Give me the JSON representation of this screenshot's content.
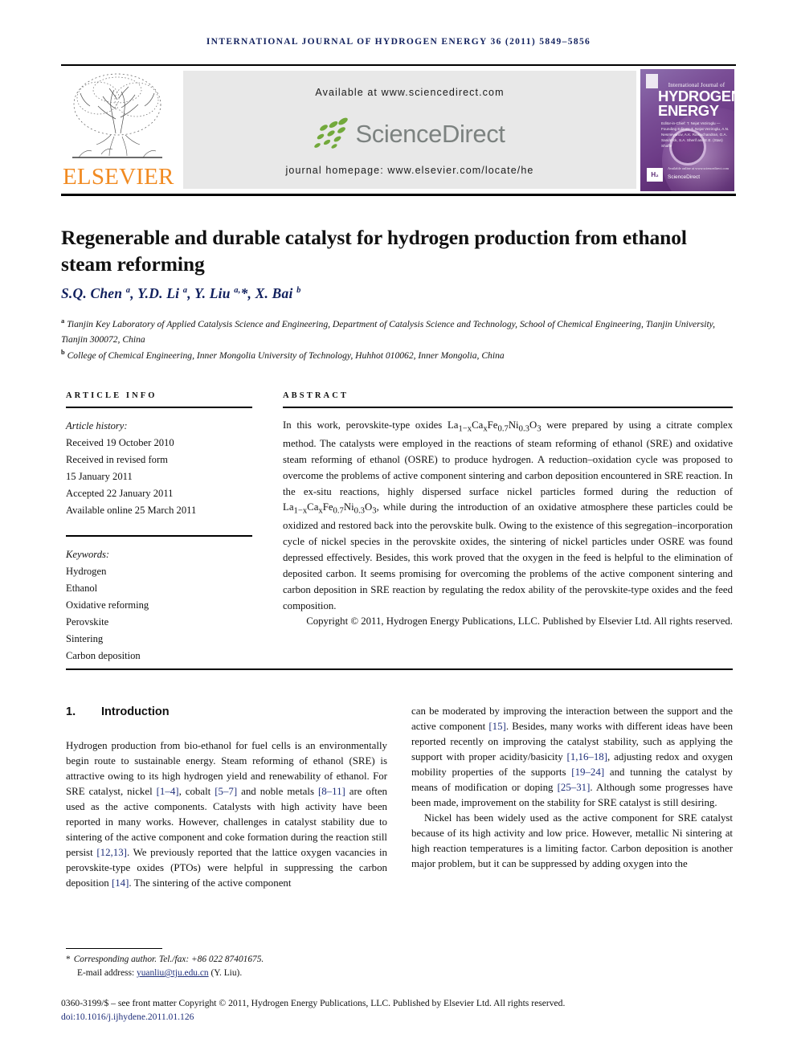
{
  "running_head": "International Journal of Hydrogen Energy 36 (2011) 5849–5856",
  "banner": {
    "publisher_name": "ELSEVIER",
    "available_at": "Available at www.sciencedirect.com",
    "sciencedirect_word": "ScienceDirect",
    "journal_homepage": "journal homepage: www.elsevier.com/locate/he",
    "cover": {
      "top_line": "International Journal of",
      "title_line1": "HYDROGEN",
      "title_line2": "ENERGY",
      "meta": "Editor-in-Chief: T. Nejat Veziroglu — Founding Editors: T. Nejat Veziroglu, A.N. Nesmeyanov, A.K. Ramachandran, G.A. Sandrock, S.A. Sherif and E.E. (Stan) Shaffe",
      "he_badge": "H₂",
      "sciencedirect_badge": "ScienceDirect",
      "bottom_note": "Available online at www.sciencedirect.com"
    }
  },
  "article": {
    "title": "Regenerable and durable catalyst for hydrogen production from ethanol steam reforming",
    "authors_html": "S.Q. Chen <sup>a</sup>, Y.D. Li <sup>a</sup>, Y. Liu <sup>a,</sup>*, X. Bai <sup>b</sup>",
    "affiliation_a": "Tianjin Key Laboratory of Applied Catalysis Science and Engineering, Department of Catalysis Science and Technology, School of Chemical Engineering, Tianjin University, Tianjin 300072, China",
    "affiliation_b": "College of Chemical Engineering, Inner Mongolia University of Technology, Huhhot 010062, Inner Mongolia, China"
  },
  "info_header": "ARTICLE INFO",
  "abstract_header": "ABSTRACT",
  "article_history": {
    "label": "Article history:",
    "lines": [
      "Received 19 October 2010",
      "Received in revised form",
      "15 January 2011",
      "Accepted 22 January 2011",
      "Available online 25 March 2011"
    ]
  },
  "keywords": {
    "label": "Keywords:",
    "items": [
      "Hydrogen",
      "Ethanol",
      "Oxidative reforming",
      "Perovskite",
      "Sintering",
      "Carbon deposition"
    ]
  },
  "abstract": {
    "part1": "In this work, perovskite-type oxides La",
    "formula1_sub1": "1−x",
    "formula1_mid1": "Ca",
    "formula1_sub2": "x",
    "formula1_mid2": "Fe",
    "formula1_sub3": "0.7",
    "formula1_mid3": "Ni",
    "formula1_sub4": "0.3",
    "formula1_mid4": "O",
    "formula1_sub5": "3",
    "part2": " were prepared by using a citrate complex method. The catalysts were employed in the reactions of steam reforming of ethanol (SRE) and oxidative steam reforming of ethanol (OSRE) to produce hydrogen. A reduction–oxidation cycle was proposed to overcome the problems of active component sintering and carbon deposition encountered in SRE reaction. In the ex-situ reactions, highly dispersed surface nickel particles formed during the reduction of La",
    "part3": ", while during the introduction of an oxidative atmosphere these particles could be oxidized and restored back into the perovskite bulk. Owing to the existence of this segregation–incorporation cycle of nickel species in the perovskite oxides, the sintering of nickel particles under OSRE was found depressed effectively. Besides, this work proved that the oxygen in the feed is helpful to the elimination of deposited carbon. It seems promising for overcoming the problems of the active component sintering and carbon deposition in SRE reaction by regulating the redox ability of the perovskite-type oxides and the feed composition.",
    "copyright": "Copyright © 2011, Hydrogen Energy Publications, LLC. Published by Elsevier Ltd. All rights reserved."
  },
  "introduction": {
    "number": "1.",
    "heading": "Introduction",
    "left_p1_a": "Hydrogen production from bio-ethanol for fuel cells is an environmentally begin route to sustainable energy. Steam reforming of ethanol (SRE) is attractive owing to its high hydrogen yield and renewability of ethanol. For SRE catalyst, nickel ",
    "left_ref1": "[1–4]",
    "left_p1_b": ", cobalt ",
    "left_ref2": "[5–7]",
    "left_p1_c": " and noble metals ",
    "left_ref3": "[8–11]",
    "left_p1_d": " are often used as the active components. Catalysts with high activity have been reported in many works. However, challenges in catalyst stability due to sintering of the active component and coke formation during the reaction still persist ",
    "left_ref4": "[12,13]",
    "left_p1_e": ". We previously reported that the lattice oxygen vacancies in perovskite-type oxides (PTOs) were helpful in suppressing the carbon deposition ",
    "left_ref5": "[14]",
    "left_p1_f": ". The sintering of the active component",
    "right_p1_a": "can be moderated by improving the interaction between the support and the active component ",
    "right_ref1": "[15]",
    "right_p1_b": ". Besides, many works with different ideas have been reported recently on improving the catalyst stability, such as applying the support with proper acidity/basicity ",
    "right_ref2": "[1,16–18]",
    "right_p1_c": ", adjusting redox and oxygen mobility properties of the supports ",
    "right_ref3": "[19–24]",
    "right_p1_d": " and tunning the catalyst by means of modification or doping ",
    "right_ref4": "[25–31]",
    "right_p1_e": ". Although some progresses have been made, improvement on the stability for SRE catalyst is still desiring.",
    "right_p2": "Nickel has been widely used as the active component for SRE catalyst because of its high activity and low price. However, metallic Ni sintering at high reaction temperatures is a limiting factor. Carbon deposition is another major problem, but it can be suppressed by adding oxygen into the"
  },
  "footer": {
    "corresponding_marker": "*",
    "corresponding_text": "Corresponding author. Tel./fax: +86 022 87401675.",
    "email_label": "E-mail address: ",
    "email_address": "yuanliu@tju.edu.cn",
    "email_suffix": " (Y. Liu).",
    "front_matter": "0360-3199/$ – see front matter Copyright © 2011, Hydrogen Energy Publications, LLC. Published by Elsevier Ltd. All rights reserved.",
    "doi": "doi:10.1016/j.ijhydene.2011.01.126"
  },
  "colors": {
    "header_navy": "#12215e",
    "elsevier_orange": "#f18a21",
    "link_blue": "#1f2f7a",
    "sciencedirect_green": "#72a93b",
    "sciencedirect_gray": "#7c8280",
    "panel_gray": "#e8e8e8"
  }
}
